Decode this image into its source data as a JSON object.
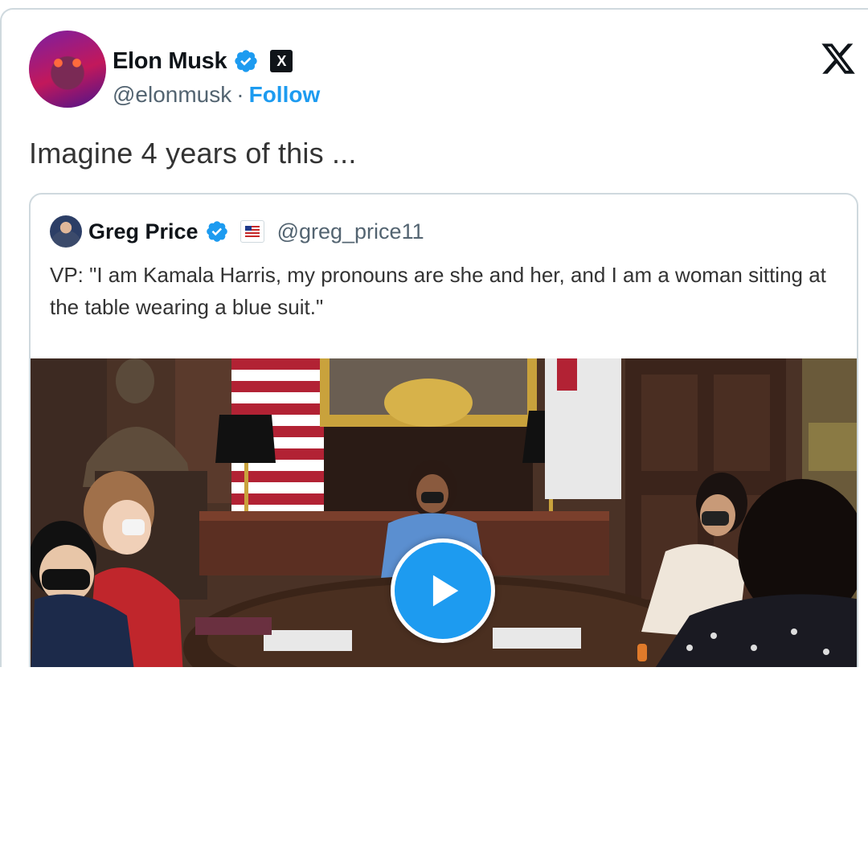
{
  "tweet": {
    "author_name": "Elon Musk",
    "handle": "@elonmusk",
    "separator": "·",
    "follow_label": "Follow",
    "badge_label": "X",
    "text": "Imagine 4 years of this ..."
  },
  "quoted_tweet": {
    "author_name": "Greg Price",
    "handle": "@greg_price11",
    "text": "VP: \"I am Kamala Harris, my pronouns are she and her, and I am a woman sitting at the table wearing a blue suit.\"",
    "media": {
      "type": "video"
    }
  },
  "colors": {
    "accent": "#1d9bf0",
    "text": "#0f1419",
    "secondary_text": "#536471",
    "border": "#cfd9de"
  },
  "icons": {
    "verified": "verified-badge-icon",
    "x_logo": "x-logo-icon",
    "play": "play-icon"
  }
}
